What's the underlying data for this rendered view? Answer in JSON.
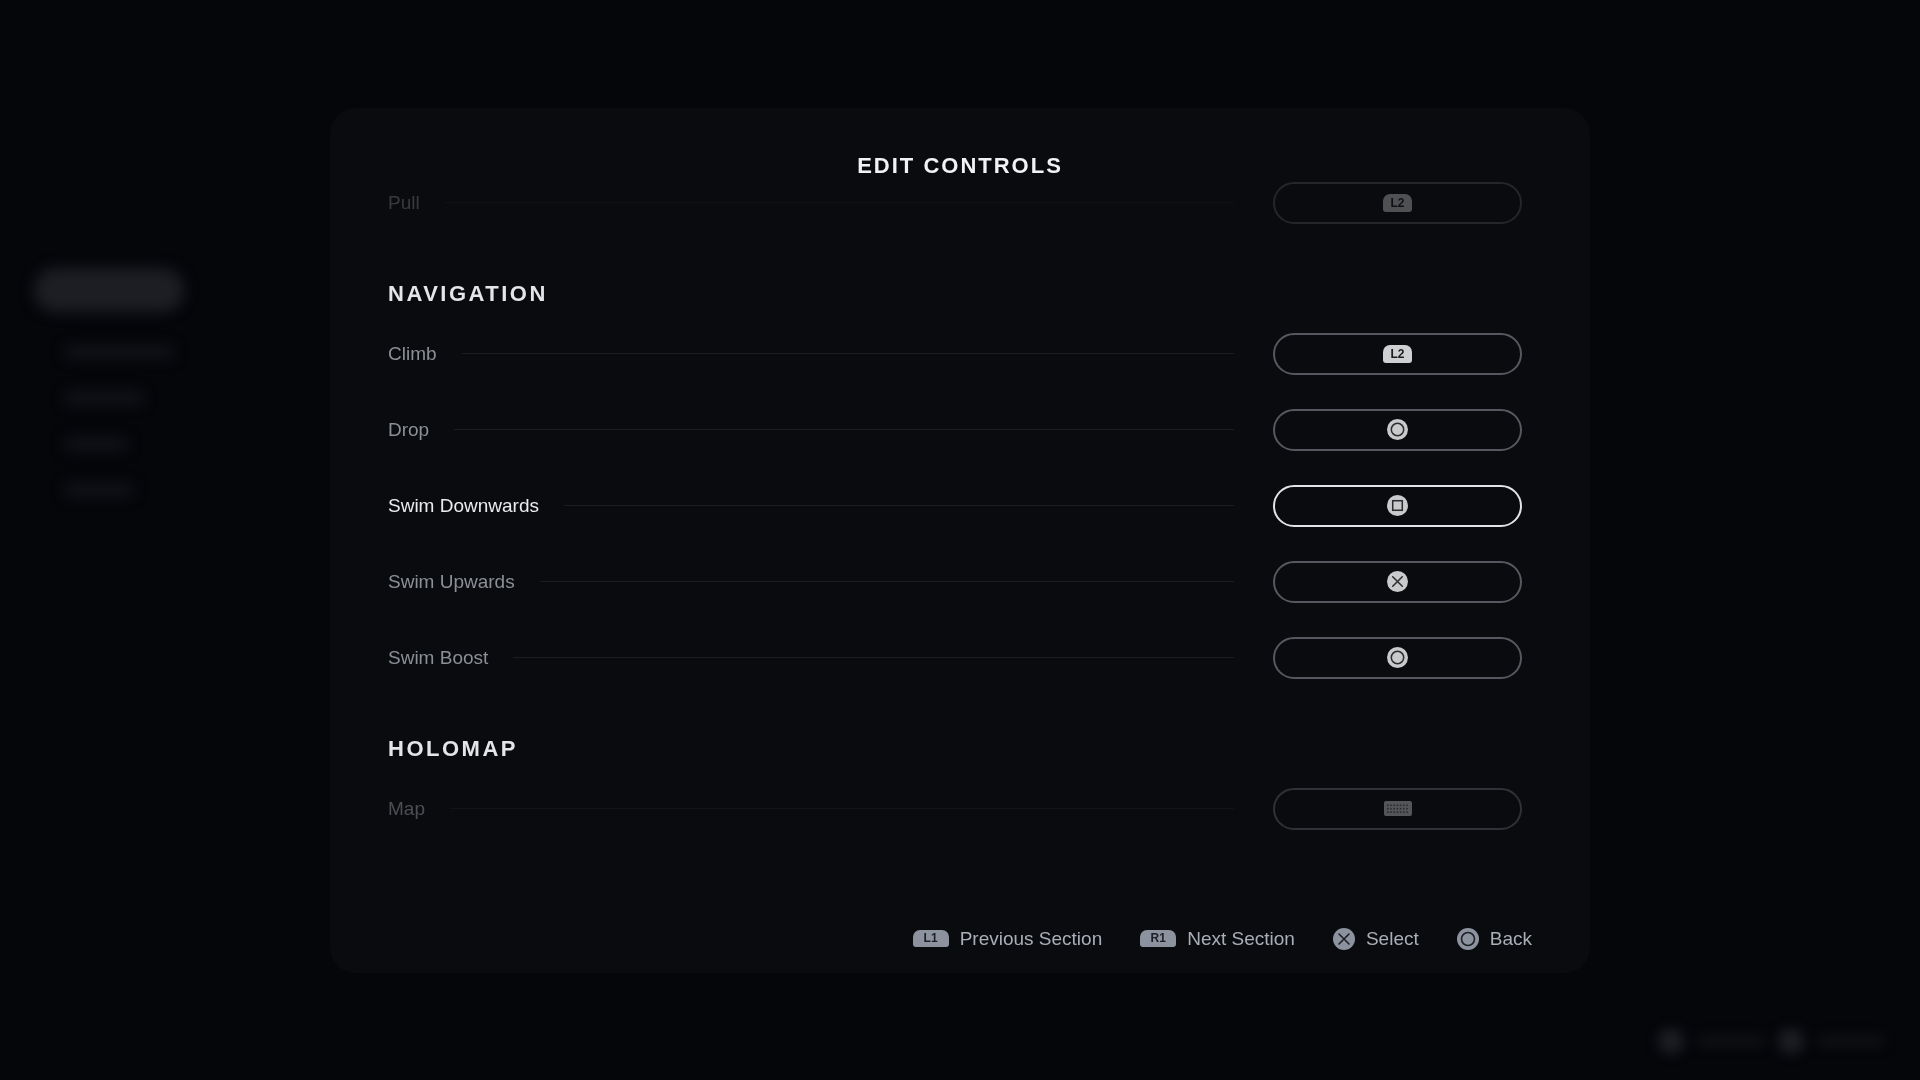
{
  "dialog": {
    "title": "EDIT CONTROLS"
  },
  "sections": [
    {
      "rows": [
        {
          "label": "Pull",
          "binding": {
            "kind": "trigger",
            "key": "L2"
          },
          "selected": false
        }
      ]
    },
    {
      "title": "NAVIGATION",
      "rows": [
        {
          "label": "Climb",
          "binding": {
            "kind": "trigger",
            "key": "L2"
          },
          "selected": false
        },
        {
          "label": "Drop",
          "binding": {
            "kind": "circle"
          },
          "selected": false
        },
        {
          "label": "Swim Downwards",
          "binding": {
            "kind": "square"
          },
          "selected": true
        },
        {
          "label": "Swim Upwards",
          "binding": {
            "kind": "cross"
          },
          "selected": false
        },
        {
          "label": "Swim Boost",
          "binding": {
            "kind": "circle"
          },
          "selected": false
        }
      ]
    },
    {
      "title": "HOLOMAP",
      "rows": [
        {
          "label": "Map",
          "binding": {
            "kind": "touchpad"
          },
          "selected": false
        }
      ]
    }
  ],
  "hints": [
    {
      "kind": "shoulder",
      "key": "L1",
      "label": "Previous Section"
    },
    {
      "kind": "shoulder",
      "key": "R1",
      "label": "Next Section"
    },
    {
      "kind": "cross",
      "label": "Select"
    },
    {
      "kind": "circle",
      "label": "Back"
    }
  ]
}
